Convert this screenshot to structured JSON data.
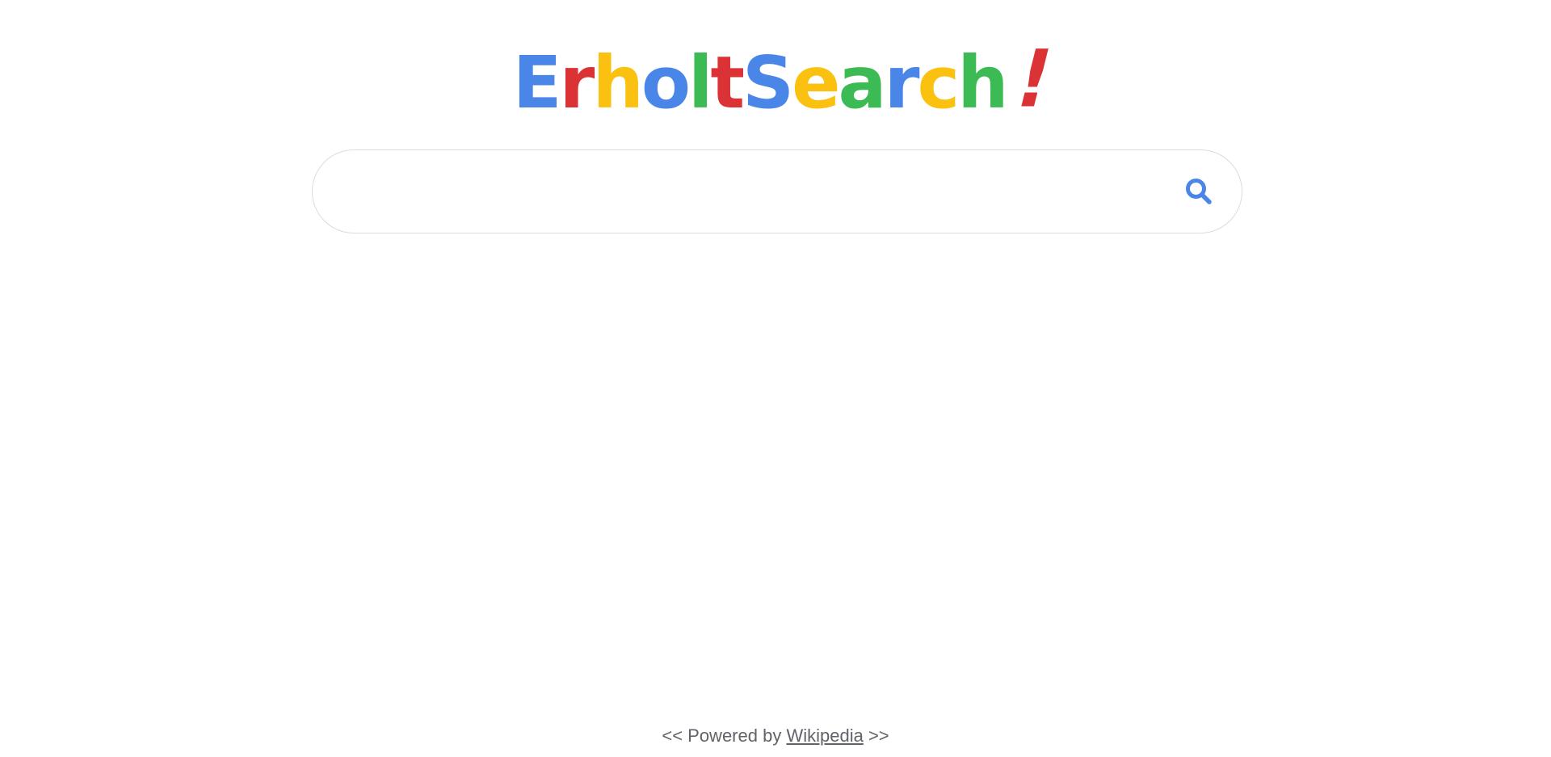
{
  "logo": {
    "letters": [
      {
        "char": "E",
        "color": "#4a86e8"
      },
      {
        "char": "r",
        "color": "#db3236"
      },
      {
        "char": "h",
        "color": "#fbc110"
      },
      {
        "char": "o",
        "color": "#4a86e8"
      },
      {
        "char": "l",
        "color": "#3cba54"
      },
      {
        "char": "t",
        "color": "#db3236"
      },
      {
        "char": "S",
        "color": "#4a86e8"
      },
      {
        "char": "e",
        "color": "#fbc110"
      },
      {
        "char": "a",
        "color": "#3cba54"
      },
      {
        "char": "r",
        "color": "#4a86e8"
      },
      {
        "char": "c",
        "color": "#fbc110"
      },
      {
        "char": "h",
        "color": "#3cba54"
      },
      {
        "char": "!",
        "color": "#db3236"
      }
    ]
  },
  "search": {
    "value": "",
    "placeholder": "",
    "button_icon": "search-icon",
    "icon_color": "#4a86e8"
  },
  "footer": {
    "prefix": "<< Powered by ",
    "link_text": "Wikipedia",
    "suffix": " >>",
    "text_color": "#606368"
  }
}
